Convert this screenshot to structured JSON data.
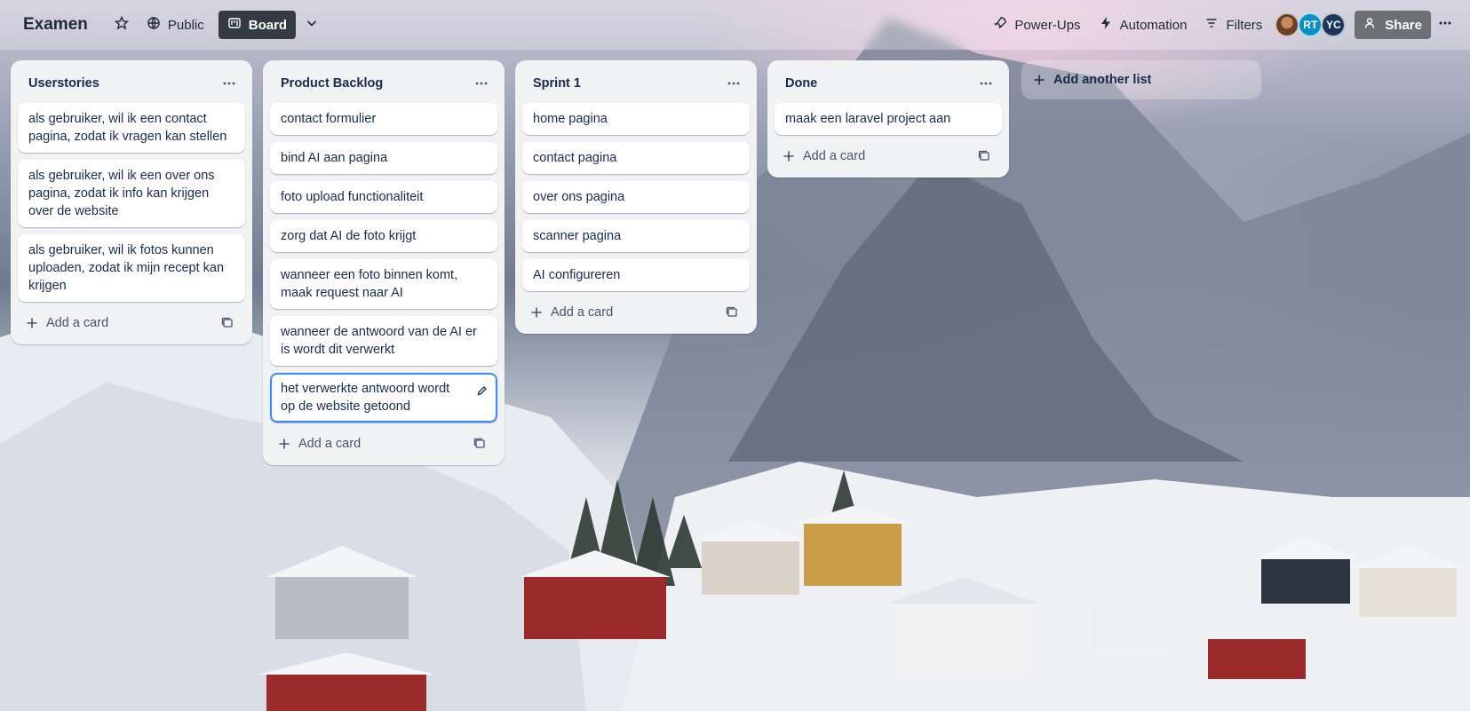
{
  "header": {
    "board_title": "Examen",
    "visibility_label": "Public",
    "view_label": "Board",
    "powerups_label": "Power-Ups",
    "automation_label": "Automation",
    "filters_label": "Filters",
    "share_label": "Share",
    "avatars": [
      {
        "initials": ""
      },
      {
        "initials": "RT"
      },
      {
        "initials": "YC"
      }
    ]
  },
  "lists": [
    {
      "title": "Userstories",
      "cards": [
        "als gebruiker, wil ik een contact pagina, zodat ik vragen kan stellen",
        "als gebruiker, wil ik een over ons pagina, zodat ik info kan krijgen over de website",
        "als gebruiker, wil ik fotos kunnen uploaden, zodat ik mijn recept kan krijgen"
      ],
      "add_card_label": "Add a card"
    },
    {
      "title": "Product Backlog",
      "cards": [
        "contact formulier",
        "bind AI aan pagina",
        "foto upload functionaliteit",
        "zorg dat AI de foto krijgt",
        "wanneer een foto binnen komt, maak request naar AI",
        "wanneer de antwoord van de AI er is wordt dit verwerkt",
        "het verwerkte antwoord wordt op de website getoond"
      ],
      "add_card_label": "Add a card"
    },
    {
      "title": "Sprint 1",
      "cards": [
        "home pagina",
        "contact pagina",
        "over ons pagina",
        "scanner pagina",
        "AI configureren"
      ],
      "add_card_label": "Add a card"
    },
    {
      "title": "Done",
      "cards": [
        "maak een laravel project aan"
      ],
      "add_card_label": "Add a card"
    }
  ],
  "add_list_label": "Add another list",
  "colors": {
    "list_bg": "#f1f2f4",
    "focus_ring": "#388bff",
    "board_button_bg": "#343a42",
    "text": "#172b4d"
  }
}
